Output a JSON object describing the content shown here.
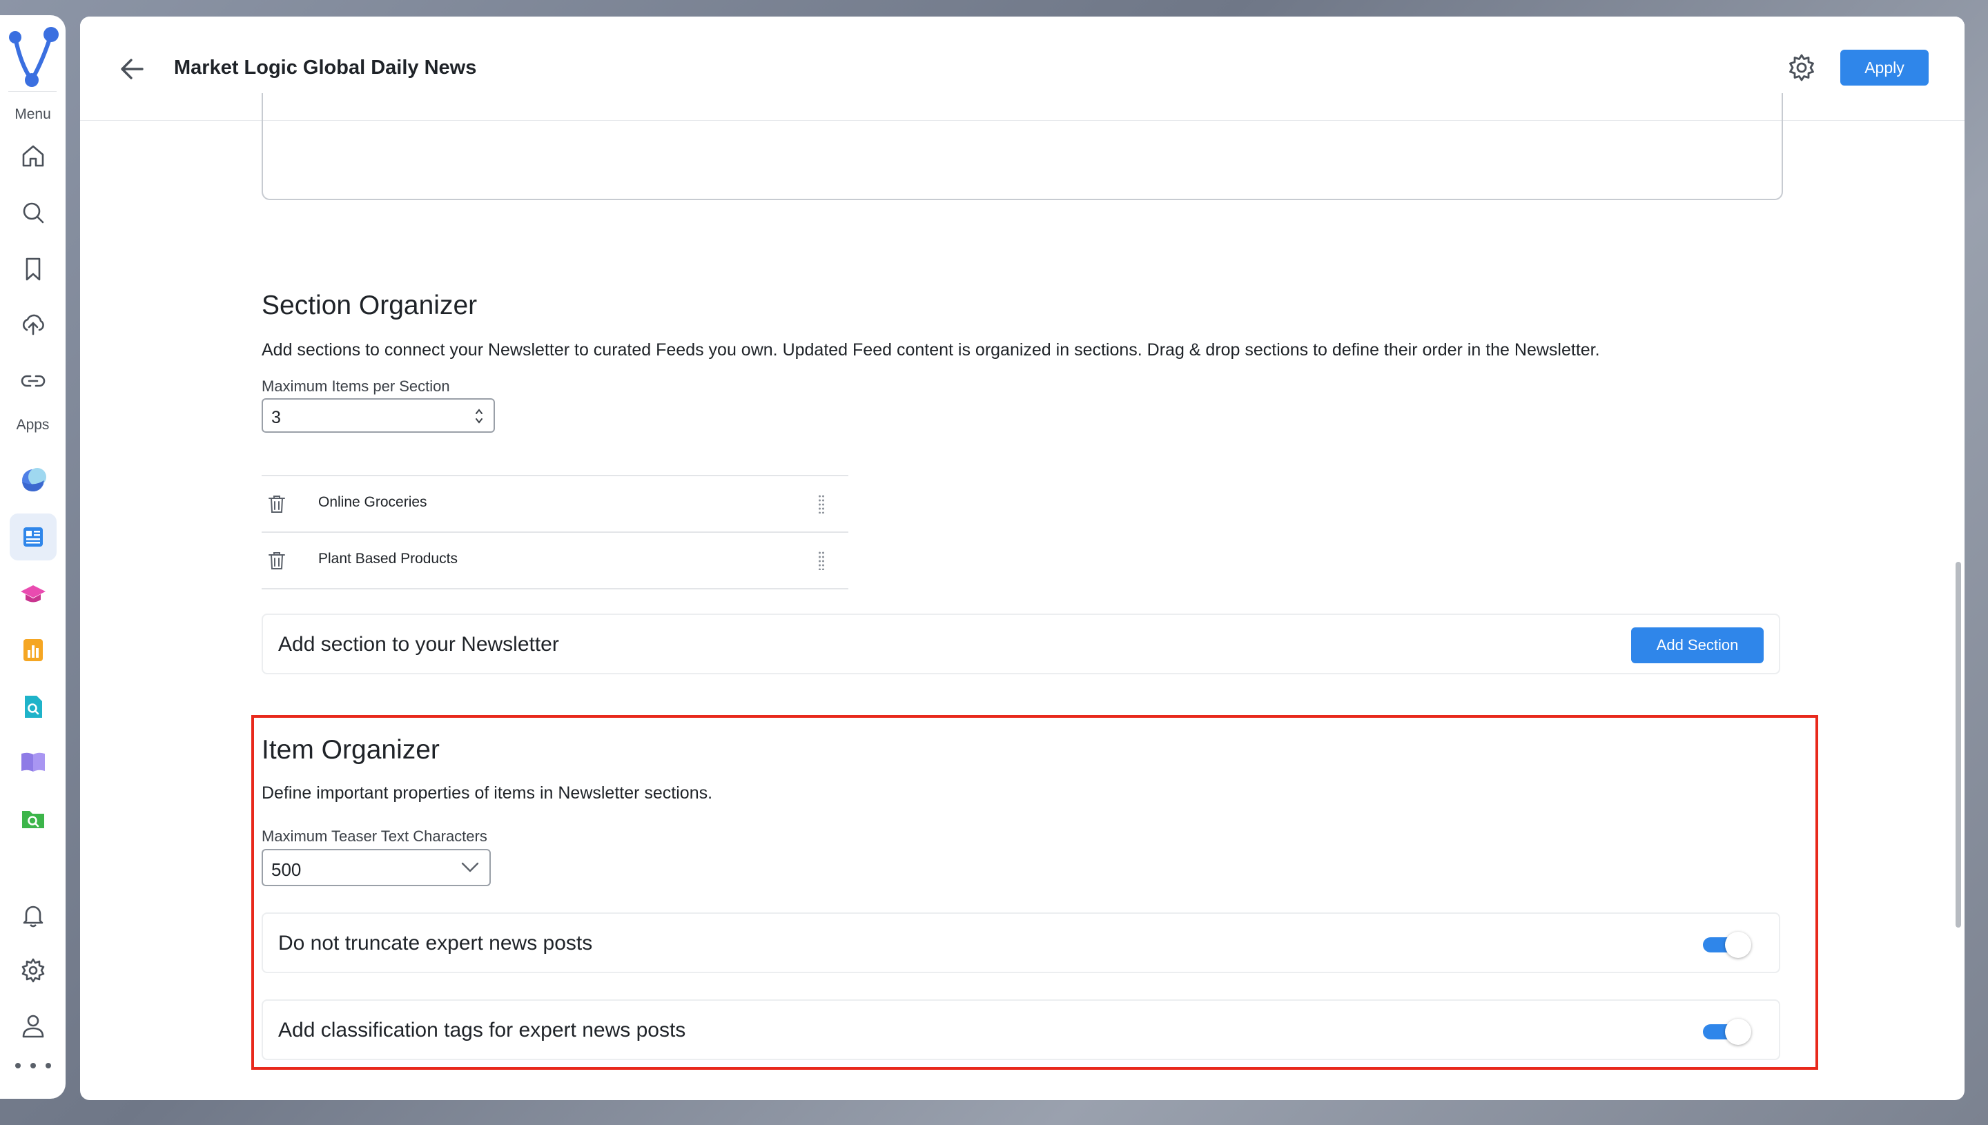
{
  "sidebar": {
    "menu_caption": "Menu",
    "apps_caption": "Apps",
    "menu_icons": [
      "home-icon",
      "search-icon",
      "bookmark-icon",
      "cloud-upload-icon",
      "link-icon"
    ],
    "app_icons": [
      "moon-app-icon",
      "newsletter-app-icon",
      "graduation-cap-app-icon",
      "bar-chart-app-icon",
      "doc-search-app-icon",
      "book-app-icon",
      "folder-search-app-icon"
    ],
    "bottom_icons": [
      "bell-icon",
      "gear-icon",
      "user-icon",
      "more-icon"
    ]
  },
  "header": {
    "title": "Market Logic Global Daily News",
    "apply_label": "Apply"
  },
  "section_organizer": {
    "heading": "Section Organizer",
    "description": "Add sections to connect your Newsletter to curated Feeds you own. Updated Feed content is organized in sections. Drag & drop sections to define their order in the Newsletter.",
    "max_items_label": "Maximum Items per Section",
    "max_items_value": "3",
    "sections": [
      "Online Groceries",
      "Plant Based Products"
    ],
    "add_text": "Add section to your Newsletter",
    "add_button_label": "Add Section"
  },
  "item_organizer": {
    "heading": "Item Organizer",
    "description": "Define important properties of items in Newsletter sections.",
    "teaser_label": "Maximum Teaser Text Characters",
    "teaser_value": "500",
    "toggles": [
      {
        "label": "Do not truncate expert news posts",
        "on": true
      },
      {
        "label": "Add classification tags for expert news posts",
        "on": true
      }
    ]
  },
  "colors": {
    "accent": "#2f86ea",
    "highlight": "#e8291c"
  }
}
